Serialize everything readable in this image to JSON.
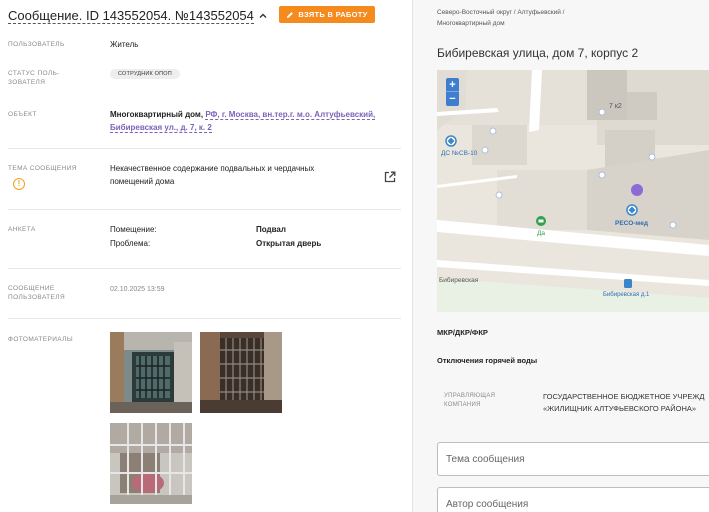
{
  "header": {
    "title": "Сообщение. ID 143552054. №143552054",
    "action_button": "ВЗЯТЬ В РАБОТУ"
  },
  "fields": {
    "user": {
      "label": "ПОЛЬЗОВАТЕЛЬ",
      "value": "Житель"
    },
    "user_status": {
      "label_line1": "СТАТУС ПОЛЬ-",
      "label_line2": "ЗОВАТЕЛЯ",
      "value": "СОТРУДНИК ОПОП"
    },
    "object": {
      "label": "ОБЪЕКТ",
      "type": "Многоквартирный дом,",
      "address_line1": "РФ, г. Москва, вн.тер.г. м.о. Алтуфьевский,",
      "address_line2": "Бибиревская ул., д. 7, к. 2"
    },
    "topic": {
      "label": "ТЕМА СООБЩЕНИЯ",
      "value_line1": "Некачественное содержание подвальных и чердачных",
      "value_line2": "помещений дома"
    },
    "form": {
      "label": "АНКЕТА",
      "rows": [
        {
          "key": "Помещение:",
          "value": "Подвал"
        },
        {
          "key": "Проблема:",
          "value": "Открытая дверь"
        }
      ]
    },
    "message": {
      "label_line1": "СООБЩЕНИЕ",
      "label_line2": "ПОЛЬЗОВАТЕЛЯ",
      "value": "02.10.2025 13:59"
    },
    "photos": {
      "label": "ФОТОМАТЕРИАЛЫ"
    }
  },
  "right": {
    "breadcrumb_line1": "Северо-Восточный округ / Алтуфьевский /",
    "breadcrumb_line2": "Многоквартирный дом",
    "address_title": "Бибиревская улица, дом 7, корпус 2",
    "map": {
      "zoom_in": "+",
      "zoom_out": "−",
      "labels": {
        "building": "7 к2",
        "poi_left": "ДС №СВ-10",
        "poi_reso": "РЕСО-мед",
        "poi_da": "Да",
        "street": "Бибиревская",
        "bus_stop": "Бибиревская д.1"
      }
    },
    "section1": "МКР/ДКР/ФКР",
    "section2": "Отключения горячей воды",
    "managing_company": {
      "label_line1": "УПРАВЛЯЮЩАЯ",
      "label_line2": "КОМПАНИЯ",
      "value_line1": "ГОСУДАРСТВЕННОЕ БЮДЖЕТНОЕ УЧРЕЖД",
      "value_line2": "«ЖИЛИЩНИК АЛТУФЬЕВСКОГО РАЙОНА»"
    },
    "inputs": {
      "topic_placeholder": "Тема сообщения",
      "author_placeholder": "Автор сообщения"
    }
  },
  "colors": {
    "accent": "#f58a1f",
    "link": "#7b63b8",
    "warning": "#f0a419",
    "map_control": "#3f7dcf"
  }
}
